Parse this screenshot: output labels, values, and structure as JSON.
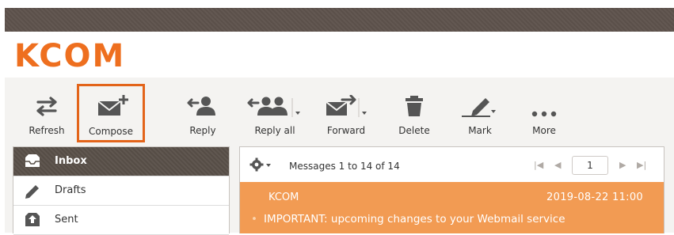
{
  "brand": {
    "logo_text": "KCOM",
    "accent": "#ee6f1f"
  },
  "toolbar": {
    "refresh": {
      "label": "Refresh",
      "icon": "refresh-icon"
    },
    "compose": {
      "label": "Compose",
      "icon": "compose-icon",
      "highlight_color": "#e3641a"
    },
    "reply": {
      "label": "Reply",
      "icon": "reply-icon"
    },
    "reply_all": {
      "label": "Reply all",
      "icon": "reply-all-icon"
    },
    "forward": {
      "label": "Forward",
      "icon": "forward-icon"
    },
    "delete": {
      "label": "Delete",
      "icon": "trash-icon"
    },
    "mark": {
      "label": "Mark",
      "icon": "pen-icon"
    },
    "more": {
      "label": "More",
      "icon": "more-dots-icon"
    }
  },
  "folders": {
    "items": [
      {
        "label": "Inbox",
        "icon": "inbox-icon",
        "active": true
      },
      {
        "label": "Drafts",
        "icon": "pencil-icon",
        "active": false
      },
      {
        "label": "Sent",
        "icon": "sent-icon",
        "active": false
      }
    ]
  },
  "messages": {
    "count_text": "Messages 1 to 14 of 14",
    "page": "1",
    "rows": [
      {
        "from": "KCOM",
        "date": "2019-08-22 11:00",
        "subject": "IMPORTANT: upcoming changes to your Webmail service",
        "bullet": "•",
        "row_color": "#f29b53"
      }
    ]
  },
  "pager": {
    "first": "|◀",
    "prev": "◀",
    "next": "▶",
    "last": "▶|"
  }
}
